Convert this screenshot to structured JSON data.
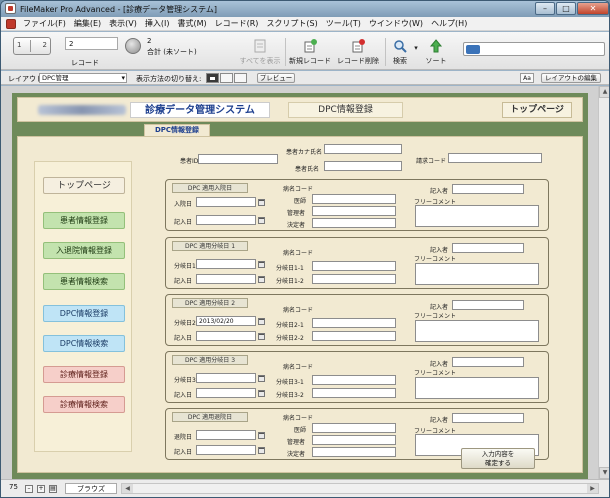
{
  "window": {
    "title": "FileMaker Pro Advanced - [診療データ管理システム]"
  },
  "menu": [
    "ファイル(F)",
    "編集(E)",
    "表示(V)",
    "挿入(I)",
    "書式(M)",
    "レコード(R)",
    "スクリプト(S)",
    "ツール(T)",
    "ウインドウ(W)",
    "ヘルプ(H)"
  ],
  "toolbar": {
    "record_number": "2",
    "record_label": "レコード",
    "total_count": "2",
    "total_text": "合計 (未ソート)",
    "show_all": "すべてを表示",
    "new_record": "新規レコード",
    "delete_record": "レコード削除",
    "find": "検索",
    "sort": "ソート",
    "book_left": "1",
    "book_right": "2"
  },
  "layoutbar": {
    "layout_label": "レイアウト:",
    "layout_value": "DPC管理",
    "view_label": "表示方法の切り替え:",
    "preview": "プレビュー",
    "aa": "Aa",
    "edit_layout": "レイアウトの編集"
  },
  "header": {
    "system_title": "診療データ管理システム",
    "dpc_title": "DPC情報登録",
    "top_page": "トップページ"
  },
  "tab_label": "DPC情報登録",
  "nav": {
    "top": "トップページ",
    "items": [
      "患者情報登録",
      "入退院情報登録",
      "患者情報検索",
      "DPC情報登録",
      "DPC情報検索",
      "診療情報登録",
      "診療情報検索"
    ]
  },
  "patient": {
    "id_label": "患者ID",
    "kana_label": "患者カナ氏名",
    "name_label": "患者氏名",
    "claim_label": "請求コード"
  },
  "common": {
    "disease_code": "病名コード",
    "doctor": "医師",
    "manager": "管理者",
    "decider": "決定者",
    "writer": "記入者",
    "free_comment": "フリーコメント",
    "entry_date": "記入日"
  },
  "sections": [
    {
      "title": "DPC 適用入院日",
      "date_label": "入院日",
      "date_value": ""
    },
    {
      "title": "DPC 適用分岐日 1",
      "date_label": "分岐日1",
      "date_value": "",
      "row1": "分岐日1-1",
      "row2": "分岐日1-2"
    },
    {
      "title": "DPC 適用分岐日 2",
      "date_label": "分岐日2",
      "date_value": "2013/02/20",
      "row1": "分岐日2-1",
      "row2": "分岐日2-2"
    },
    {
      "title": "DPC 適用分岐日 3",
      "date_label": "分岐日3",
      "date_value": "",
      "row1": "分岐日3-1",
      "row2": "分岐日3-2"
    },
    {
      "title": "DPC 適用退院日",
      "date_label": "退院日",
      "date_value": ""
    }
  ],
  "submit": {
    "line1": "入力内容を",
    "line2": "確定する"
  },
  "status": {
    "zoom": "75",
    "mode": "ブラウズ"
  }
}
